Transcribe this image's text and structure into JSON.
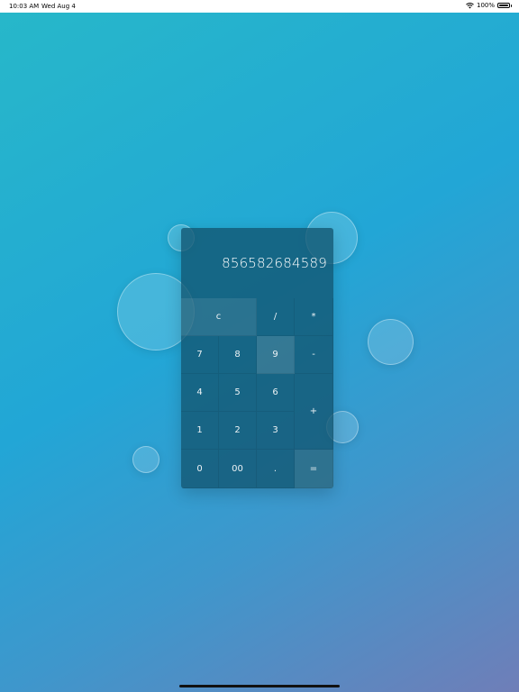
{
  "status_bar": {
    "time": "10:03 AM",
    "date": "Wed Aug 4",
    "battery": "100%",
    "icons": [
      "wifi-icon",
      "battery-icon"
    ]
  },
  "calculator": {
    "display": "856582684589",
    "keys": {
      "clear": "c",
      "divide": "/",
      "multiply": "*",
      "seven": "7",
      "eight": "8",
      "nine": "9",
      "minus": "-",
      "four": "4",
      "five": "5",
      "six": "6",
      "plus": "+",
      "one": "1",
      "two": "2",
      "three": "3",
      "zero": "0",
      "double_zero": "00",
      "decimal": ".",
      "equals": "="
    }
  },
  "colors": {
    "background_top": "#27b8c9",
    "background_mid": "#22a6d6",
    "background_bottom": "#6f7eb8",
    "calculator_body": "#125570"
  }
}
